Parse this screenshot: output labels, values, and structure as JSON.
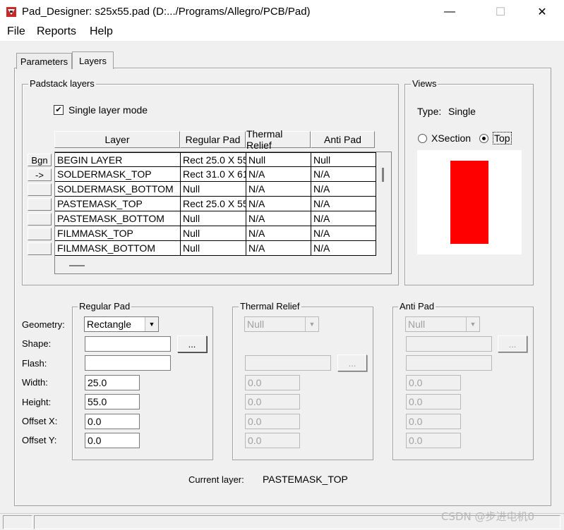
{
  "window": {
    "title": "Pad_Designer: s25x55.pad (D:.../Programs/Allegro/PCB/Pad)",
    "minimize_glyph": "—",
    "maximize_glyph": "☐",
    "close_glyph": "✕"
  },
  "menu": [
    "File",
    "Reports",
    "Help"
  ],
  "tabs": [
    {
      "label": "Parameters",
      "active": false
    },
    {
      "label": "Layers",
      "active": true
    }
  ],
  "padstack_layers": {
    "group_label": "Padstack layers",
    "single_layer_mode": {
      "label": "Single layer mode",
      "checked": true,
      "mark": "✔"
    },
    "columns": [
      "Layer",
      "Regular Pad",
      "Thermal Relief",
      "Anti Pad"
    ],
    "row_buttons": [
      "Bgn",
      "->",
      "",
      "",
      "",
      "",
      ""
    ],
    "rows": [
      [
        "BEGIN LAYER",
        "Rect 25.0 X 55",
        "Null",
        "Null"
      ],
      [
        "SOLDERMASK_TOP",
        "Rect 31.0 X 61",
        "N/A",
        "N/A"
      ],
      [
        "SOLDERMASK_BOTTOM",
        "Null",
        "N/A",
        "N/A"
      ],
      [
        "PASTEMASK_TOP",
        "Rect 25.0 X 55",
        "N/A",
        "N/A"
      ],
      [
        "PASTEMASK_BOTTOM",
        "Null",
        "N/A",
        "N/A"
      ],
      [
        "FILMMASK_TOP",
        "Null",
        "N/A",
        "N/A"
      ],
      [
        "FILMMASK_BOTTOM",
        "Null",
        "N/A",
        "N/A"
      ]
    ]
  },
  "views": {
    "group_label": "Views",
    "type_label": "Type:",
    "type_value": "Single",
    "options": [
      {
        "label": "XSection",
        "selected": false
      },
      {
        "label": "Top",
        "selected": true
      }
    ],
    "pad_color": "#ff0000"
  },
  "field_labels": [
    "Geometry:",
    "Shape:",
    "Flash:",
    "Width:",
    "Height:",
    "Offset X:",
    "Offset Y:"
  ],
  "regular_pad": {
    "group_label": "Regular Pad",
    "geometry": "Rectangle",
    "shape": "",
    "flash": "",
    "browse_label": "...",
    "width": "25.0",
    "height": "55.0",
    "offset_x": "0.0",
    "offset_y": "0.0"
  },
  "thermal_relief": {
    "group_label": "Thermal Relief",
    "geometry": "Null",
    "flash": "",
    "browse_label": "...",
    "width": "0.0",
    "height": "0.0",
    "offset_x": "0.0",
    "offset_y": "0.0"
  },
  "anti_pad": {
    "group_label": "Anti Pad",
    "geometry": "Null",
    "shape": "",
    "flash": "",
    "browse_label": "...",
    "width": "0.0",
    "height": "0.0",
    "offset_x": "0.0",
    "offset_y": "0.0"
  },
  "current_layer": {
    "label": "Current layer:",
    "value": "PASTEMASK_TOP"
  },
  "watermark": "CSDN @步进电机0"
}
